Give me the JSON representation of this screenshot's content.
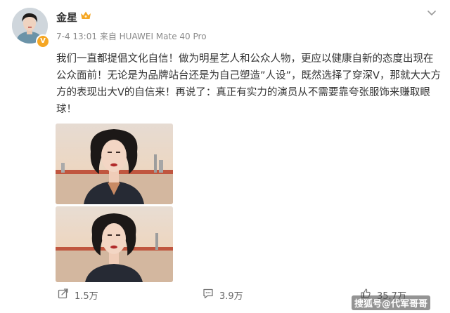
{
  "user": {
    "name": "金星",
    "verified_badge": "V"
  },
  "meta": {
    "time": "7-4 13:01",
    "source": "来自 HUAWEI Mate 40 Pro"
  },
  "post": {
    "text": "我们一直都提倡文化自信！做为明星艺人和公众人物，更应以健康自新的态度出现在公众面前！无论是为品牌站台还是为自己塑造”人设”，既然选择了穿深V，那就大大方方的表现出大V的自信来！再说了：真正有实力的演员从不需要靠夸张服饰来赚取眼球！"
  },
  "actions": {
    "share_count": "1.5万",
    "comment_count": "3.9万",
    "like_count": "35.7万"
  },
  "watermark": "搜狐号@代军哥哥",
  "icons": {
    "crown": "crown-icon",
    "more": "chevron-down-icon",
    "share": "share-icon",
    "comment": "comment-icon",
    "like": "like-icon"
  },
  "colors": {
    "verified": "#f5a623",
    "crown": "#f5a623",
    "text": "#333333",
    "meta": "#8a8a8a"
  }
}
